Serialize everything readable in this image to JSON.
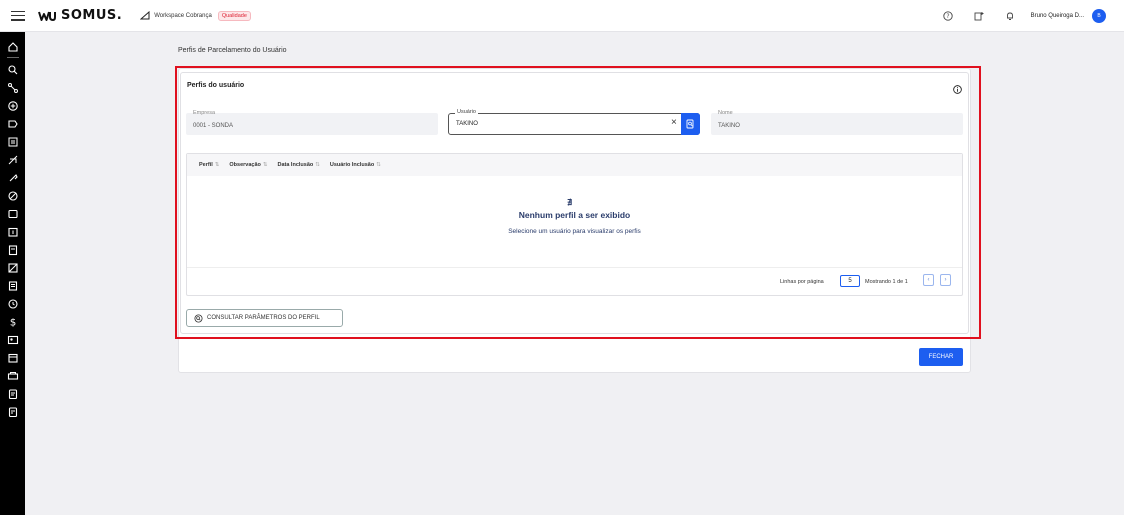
{
  "topbar": {
    "logo_text": "SOMUS.",
    "workspace": "Workspace Cobrança",
    "env_badge": "Qualidade",
    "user_name": "Bruno Queiroga D...",
    "avatar_initial": "B",
    "accent": "#1d5ef0"
  },
  "sidebar": {
    "icons": [
      "home-icon",
      "search-icon",
      "network-icon",
      "add-circle-icon",
      "play-icon",
      "list-icon",
      "no-sign-icon",
      "wrench-icon",
      "slash-circle-icon",
      "chat-icon",
      "calendar-icon",
      "clipboard-icon",
      "box-slash-icon",
      "document-icon",
      "history-icon",
      "dollar-icon",
      "id-card-icon",
      "wallet-icon",
      "printer-icon",
      "file-icon",
      "note-icon"
    ]
  },
  "page": {
    "title": "Perfis de Parcelamento do Usuário",
    "card_title": "Perfis do usuário",
    "fields": {
      "empresa": {
        "label": "Empresa",
        "value": "0001 - SONDA"
      },
      "usuario": {
        "label": "Usuário",
        "value": "TAKINO"
      },
      "nome": {
        "label": "Nome",
        "value": "TAKINO"
      }
    },
    "table": {
      "columns": [
        "Perfil",
        "Observação",
        "Data Inclusão",
        "Usuário Inclusão"
      ],
      "empty_icon": "∄",
      "empty_title": "Nenhum perfil a ser exibido",
      "empty_subtitle": "Selecione um usuário para visualizar os perfis",
      "rows_per_page_label": "Linhas por página",
      "rows_per_page": "5",
      "showing": "Mostrando 1 de 1",
      "prev": "‹",
      "next": "›"
    },
    "consult_button": "CONSULTAR PARÂMETROS DO PERFIL",
    "close_button": "FECHAR",
    "highlight_color": "#e0101e"
  }
}
